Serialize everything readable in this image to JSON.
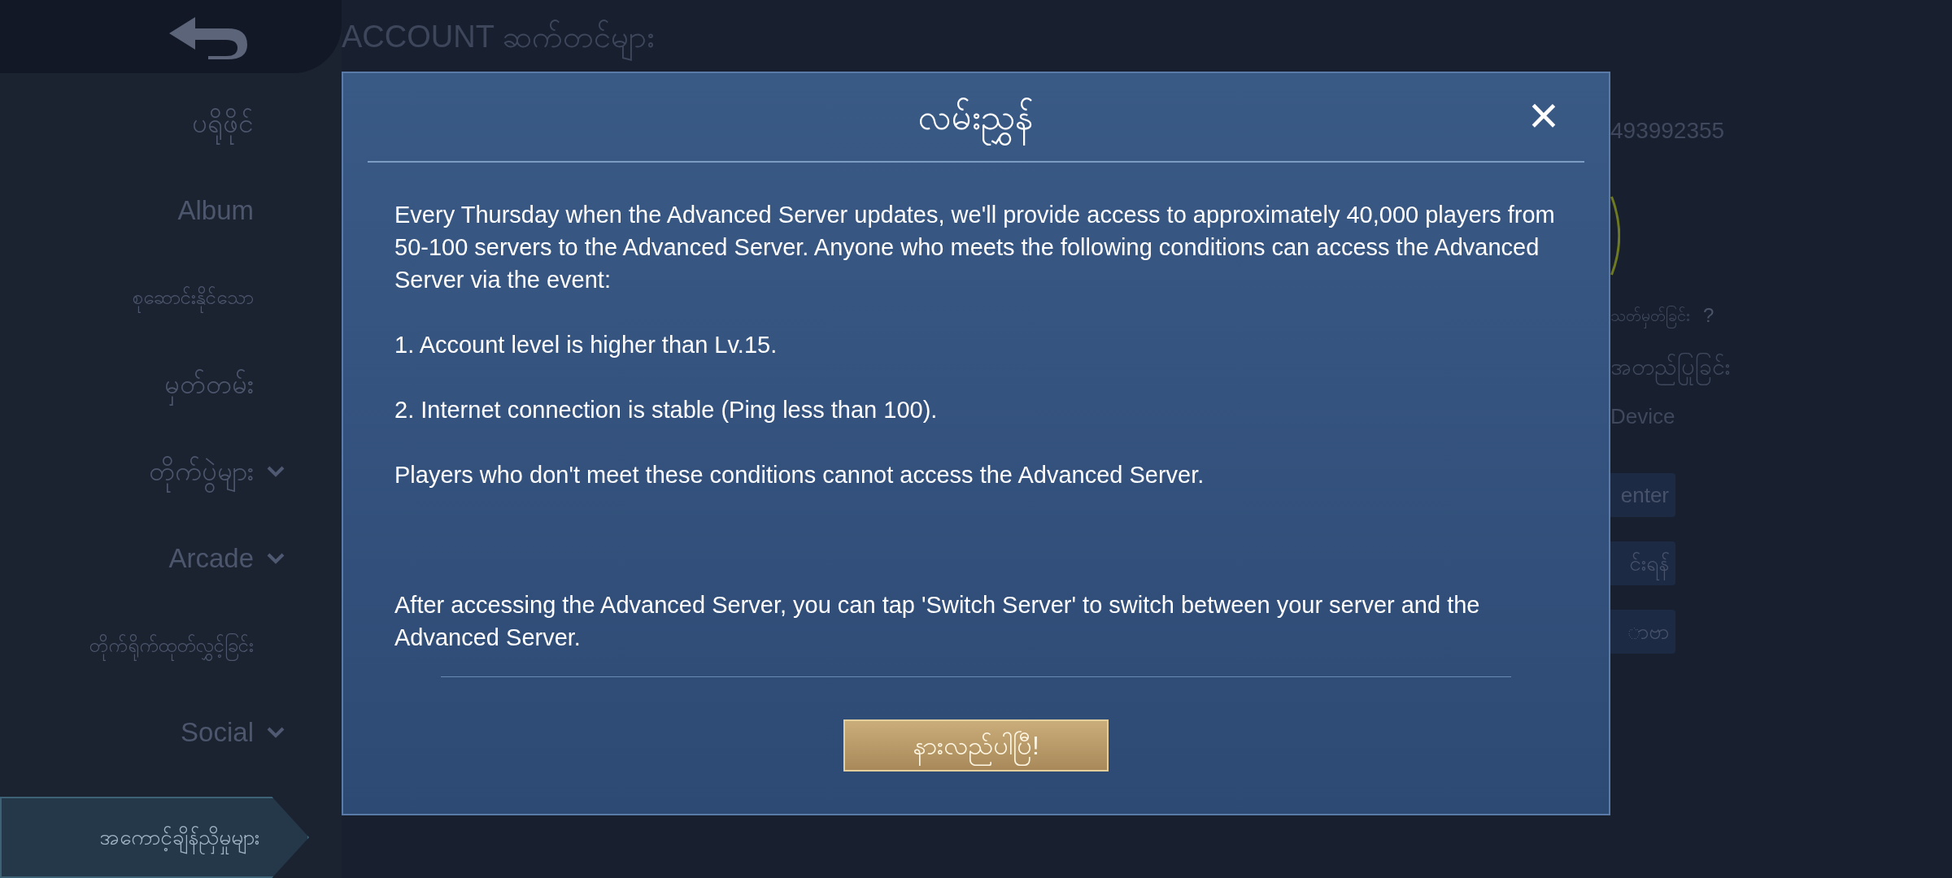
{
  "header": {
    "title": "ACCOUNT ဆက်တင်များ"
  },
  "sidebar": {
    "items": [
      {
        "label": "ပရိုဖိုင်",
        "expandable": false,
        "selected": false
      },
      {
        "label": "Album",
        "expandable": false,
        "selected": false
      },
      {
        "label": "စုဆောင်းနိုင်သော",
        "expandable": false,
        "selected": false
      },
      {
        "label": "မှတ်တမ်း",
        "expandable": false,
        "selected": false
      },
      {
        "label": "တိုက်ပွဲများ",
        "expandable": true,
        "selected": false
      },
      {
        "label": "Arcade",
        "expandable": true,
        "selected": false
      },
      {
        "label": "တိုက်ရိုက်ထုတ်လွှင့်ခြင်း",
        "expandable": false,
        "selected": false
      },
      {
        "label": "Social",
        "expandable": true,
        "selected": false
      },
      {
        "label": "အကောင့်ချိန်ညှိမှုများ",
        "expandable": false,
        "selected": true
      }
    ]
  },
  "account_panel": {
    "id_fragment": "493992355",
    "setting_fragment": "သတ်မှတ်ခြင်း",
    "help_mark": "?",
    "verify_fragment": "အတည်ပြုခြင်း",
    "device_fragment": "Device",
    "buttons": [
      "enter",
      "င်းရန်",
      "ာဗာ"
    ]
  },
  "dialog": {
    "title": "လမ်းညွှန်",
    "close": "×",
    "paragraphs": [
      "Every Thursday when the Advanced Server updates, we'll provide access to approximately 40,000 players from 50-100 servers to the Advanced Server. Anyone who meets the following conditions can access the Advanced Server via the event:",
      "1. Account level is higher than Lv.15.",
      "2. Internet connection is stable (Ping less than 100).",
      "Players who don't meet these conditions cannot access the Advanced Server.",
      "After accessing the Advanced Server, you can tap 'Switch Server' to switch between your server and the Advanced Server."
    ],
    "confirm_button": "နားလည်ပါပြီ!"
  }
}
